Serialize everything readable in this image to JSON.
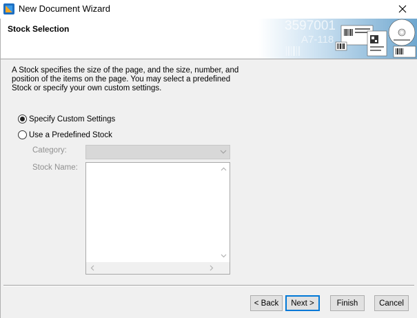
{
  "window": {
    "title": "New Document Wizard",
    "app_icon": "wizard-app-icon",
    "close_icon": "close-icon"
  },
  "header": {
    "title": "Stock Selection",
    "art_text_1": "3597001",
    "art_text_2": "A7-118"
  },
  "description": "A Stock specifies the size of the page, and the size, number, and position of the items on the page. You may select a predefined Stock or specify your own custom settings.",
  "options": {
    "custom": {
      "label": "Specify Custom Settings",
      "selected": true
    },
    "predefined": {
      "label": "Use a Predefined Stock",
      "selected": false
    }
  },
  "fields": {
    "category_label": "Category:",
    "category_value": "",
    "stock_name_label": "Stock Name:"
  },
  "buttons": {
    "back": "< Back",
    "next": "Next >",
    "finish": "Finish",
    "cancel": "Cancel"
  }
}
